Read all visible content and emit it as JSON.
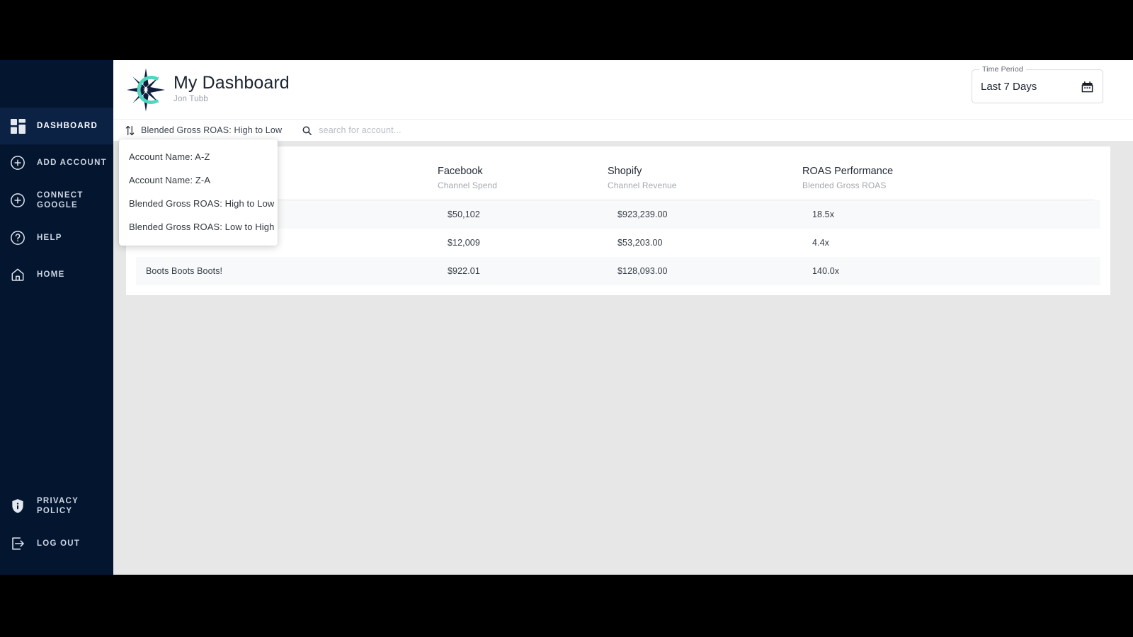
{
  "sidebar": {
    "items": [
      {
        "label": "DASHBOARD",
        "icon": "grid-dashboard-icon",
        "active": true
      },
      {
        "label": "ADD ACCOUNT",
        "icon": "plus-circle-icon",
        "active": false
      },
      {
        "label": "CONNECT\nGOOGLE",
        "icon": "plus-circle-icon",
        "active": false
      },
      {
        "label": "HELP",
        "icon": "question-circle-icon",
        "active": false
      },
      {
        "label": "HOME",
        "icon": "home-icon",
        "active": false
      }
    ],
    "bottom_items": [
      {
        "label": "PRIVACY\nPOLICY",
        "icon": "shield-info-icon"
      },
      {
        "label": "LOG OUT",
        "icon": "logout-arrow-icon"
      }
    ]
  },
  "header": {
    "logo": "compass-c-logo-icon",
    "title": "My Dashboard",
    "subtitle": "Jon Tubb",
    "time_period": {
      "legend": "Time Period",
      "value": "Last 7 Days",
      "icon": "calendar-icon"
    }
  },
  "toolbar": {
    "sort_icon": "sort-arrows-icon",
    "sort_value": "Blended Gross ROAS: High to Low",
    "search_icon": "search-icon",
    "search_value": "",
    "search_placeholder": "search for account..."
  },
  "sort_menu": {
    "open": true,
    "options": [
      "Account Name: A-Z",
      "Account Name: Z-A",
      "Blended Gross ROAS: High to Low",
      "Blended Gross ROAS: Low to High"
    ]
  },
  "table": {
    "columns": [
      {
        "main": "",
        "sub": ""
      },
      {
        "main": "Facebook",
        "sub": "Channel Spend"
      },
      {
        "main": "Shopify",
        "sub": "Channel Revenue"
      },
      {
        "main": "ROAS Performance",
        "sub": "Blended Gross ROAS"
      }
    ],
    "rows": [
      {
        "account": "",
        "facebook": "$50,102",
        "shopify": "$923,239.00",
        "roas": "18.5x"
      },
      {
        "account": "",
        "facebook": "$12,009",
        "shopify": "$53,203.00",
        "roas": "4.4x"
      },
      {
        "account": "Boots Boots Boots!",
        "facebook": "$922.01",
        "shopify": "$128,093.00",
        "roas": "140.0x"
      }
    ]
  },
  "colors": {
    "sidebar_bg": "#041530",
    "sidebar_active_bg": "#0c2245",
    "page_bg": "#e7e7e7",
    "card_bg": "#ffffff",
    "row_stripe": "#f8f9fa",
    "logo_accent": "#4fd6c0",
    "logo_dark": "#0f1c3d"
  }
}
